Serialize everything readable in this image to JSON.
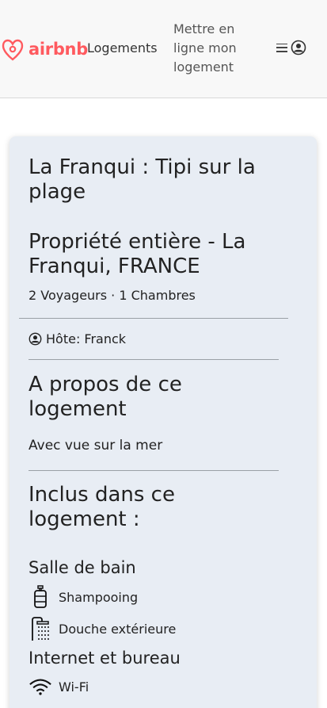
{
  "header": {
    "logo_text": "airbnb",
    "brand_color": "#ff5a5f",
    "nav_logements": "Logements",
    "nav_host": "Mettre en ligne mon logement",
    "menu_icon": "hamburger-icon",
    "profile_icon": "user-circle-icon"
  },
  "listing": {
    "title": "La Franqui : Tipi sur la plage",
    "subtitle": "Propriété entière - La Franqui, FRANCE",
    "meta": "2 Voyageurs · 1 Chambres",
    "host": "Hôte: Franck",
    "about_heading": "A propos de ce logement",
    "about_text": "Avec vue sur la mer",
    "included_heading": "Inclus dans ce logement :",
    "categories": [
      {
        "name": "Salle de bain",
        "amenities": [
          {
            "label": "Shampooing",
            "icon": "shampoo-bottle-icon"
          },
          {
            "label": "Douche extérieure",
            "icon": "shower-icon"
          }
        ]
      },
      {
        "name": "Internet et bureau",
        "amenities": [
          {
            "label": "Wi-Fi",
            "icon": "wifi-icon"
          }
        ]
      }
    ]
  }
}
